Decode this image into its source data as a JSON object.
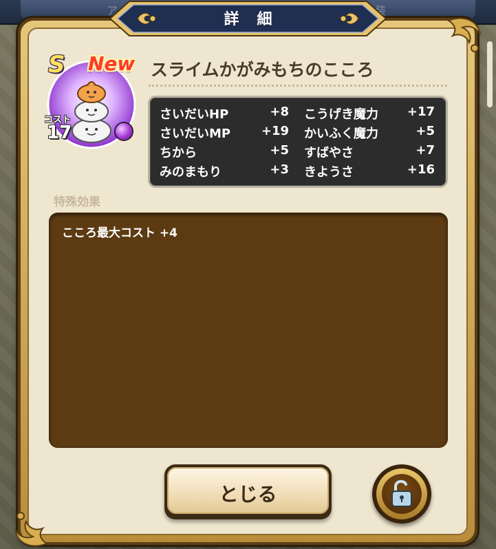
{
  "background": {
    "ghost_tab_left": "ア",
    "ghost_tab_right": "装"
  },
  "dialog": {
    "title": "詳細",
    "item": {
      "rank": "S",
      "new_badge": "New",
      "name": "スライムかがみもちのこころ",
      "cost_label": "コスト",
      "cost_value": "17",
      "orb_color": "#a43ad6"
    },
    "stats": {
      "left": [
        {
          "label": "さいだいHP",
          "value": "+8"
        },
        {
          "label": "さいだいMP",
          "value": "+19"
        },
        {
          "label": "ちから",
          "value": "+5"
        },
        {
          "label": "みのまもり",
          "value": "+3"
        }
      ],
      "right": [
        {
          "label": "こうげき魔力",
          "value": "+17"
        },
        {
          "label": "かいふく魔力",
          "value": "+5"
        },
        {
          "label": "すばやさ",
          "value": "+7"
        },
        {
          "label": "きようさ",
          "value": "+16"
        }
      ]
    },
    "special_effects": {
      "label": "特殊効果",
      "text": "こころ最大コスト +4"
    },
    "close_button_label": "とじる",
    "lock_icon": "unlocked-padlock-icon"
  },
  "colors": {
    "panel_bg": "#efe6d0",
    "effect_bg": "#5c3a12",
    "stats_bg": "#2c2c2c",
    "title_plate": "#1f2f52",
    "gold": "#d9ae4f"
  }
}
